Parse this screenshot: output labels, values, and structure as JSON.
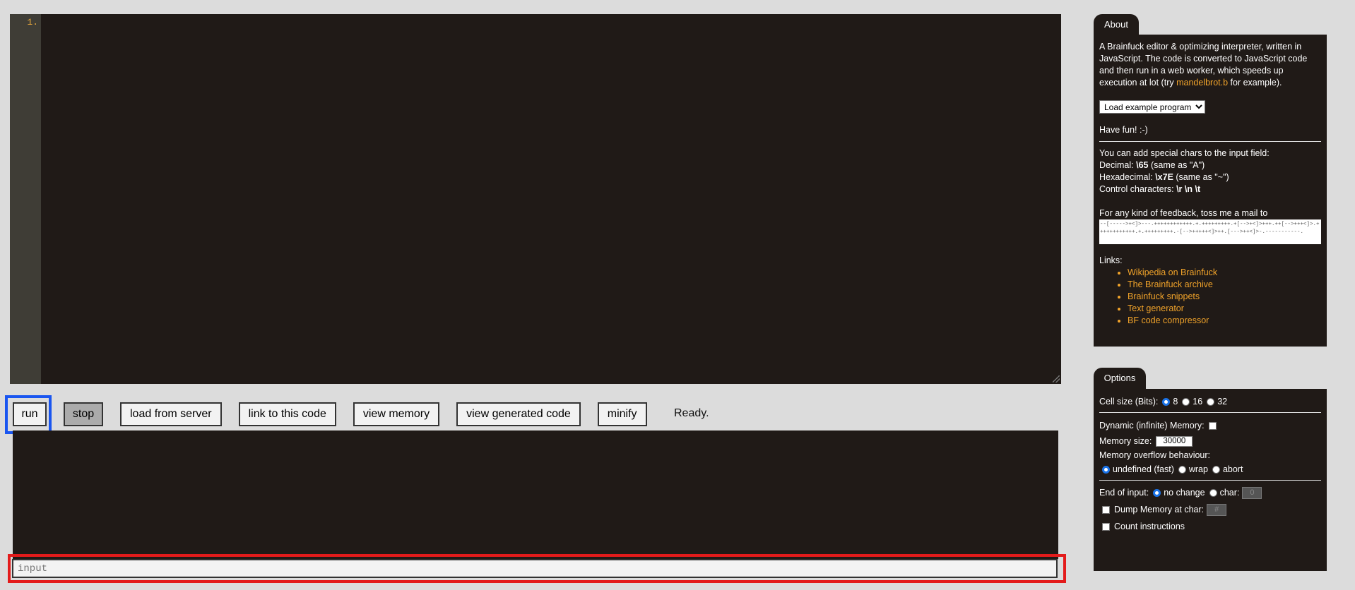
{
  "editor": {
    "line_number": "1."
  },
  "toolbar": {
    "run": "run",
    "stop": "stop",
    "load_from_server": "load from server",
    "link_to_code": "link to this code",
    "view_memory": "view memory",
    "view_generated_code": "view generated code",
    "minify": "minify"
  },
  "status": "Ready.",
  "input": {
    "placeholder": "input"
  },
  "about": {
    "tab": "About",
    "intro_1": "A Brainfuck editor & optimizing interpreter, written in JavaScript. The code is converted to JavaScript code and then run in a web worker, which speeds up execution at lot (try ",
    "intro_link": "mandelbrot.b",
    "intro_2": " for example).",
    "select_label": "Load example program",
    "have_fun": "Have fun! :-)",
    "special_chars": "You can add special chars to the input field:",
    "decimal_label": "Decimal: ",
    "decimal_code": "\\65",
    "decimal_note": " (same as \"A\")",
    "hex_label": "Hexadecimal: ",
    "hex_code": "\\x7E",
    "hex_note": " (same as \"~\")",
    "control_label": "Control characters: ",
    "control_code": "\\r \\n \\t",
    "feedback": "For any kind of feedback, toss me a mail to",
    "mail_code": "--[----->+<]>---.++++++++++++.+.+++++++++.+[-->+<]>+++.++[-->+++<]>.++++++++++++.+.+++++++++.-[-->+++++<]>++.[--->++<]>-.-----------.",
    "links_label": "Links:",
    "links": [
      "Wikipedia on Brainfuck",
      "The Brainfuck archive",
      "Brainfuck snippets",
      "Text generator",
      "BF code compressor"
    ]
  },
  "options": {
    "tab": "Options",
    "cell_size_label": "Cell size (Bits):",
    "cell_sizes": [
      "8",
      "16",
      "32"
    ],
    "cell_size_selected": "8",
    "dynamic_memory": "Dynamic (infinite) Memory:",
    "memory_size_label": "Memory size:",
    "memory_size": "30000",
    "overflow_label": "Memory overflow behaviour:",
    "overflow_options": [
      "undefined (fast)",
      "wrap",
      "abort"
    ],
    "overflow_selected": "undefined (fast)",
    "end_of_input": "End of input:",
    "no_change": "no change",
    "char": "char:",
    "char_value": "0",
    "dump_memory": "Dump Memory at char:",
    "dump_char": "#",
    "count_instructions": "Count instructions"
  },
  "colors": {
    "panel_bg": "#201a17",
    "accent_orange": "#f1a32a",
    "highlight_blue": "#1a56f0",
    "highlight_red": "#e31b1b"
  }
}
